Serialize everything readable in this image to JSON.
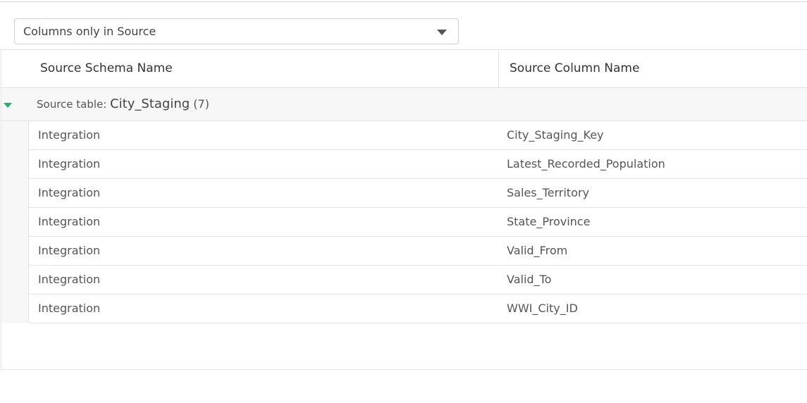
{
  "filter": {
    "selected": "Columns only in Source"
  },
  "headers": {
    "schema": "Source Schema Name",
    "column": "Source Column Name"
  },
  "group": {
    "prefix": "Source table: ",
    "name": "City_Staging",
    "count": "(7)"
  },
  "rows": [
    {
      "schema": "Integration",
      "column": "City_Staging_Key"
    },
    {
      "schema": "Integration",
      "column": "Latest_Recorded_Population"
    },
    {
      "schema": "Integration",
      "column": "Sales_Territory"
    },
    {
      "schema": "Integration",
      "column": "State_Province"
    },
    {
      "schema": "Integration",
      "column": "Valid_From"
    },
    {
      "schema": "Integration",
      "column": "Valid_To"
    },
    {
      "schema": "Integration",
      "column": "WWI_City_ID"
    }
  ],
  "colors": {
    "accent": "#2eaa6e",
    "border": "#e2e2e2",
    "group_bg": "#f7f7f7"
  }
}
